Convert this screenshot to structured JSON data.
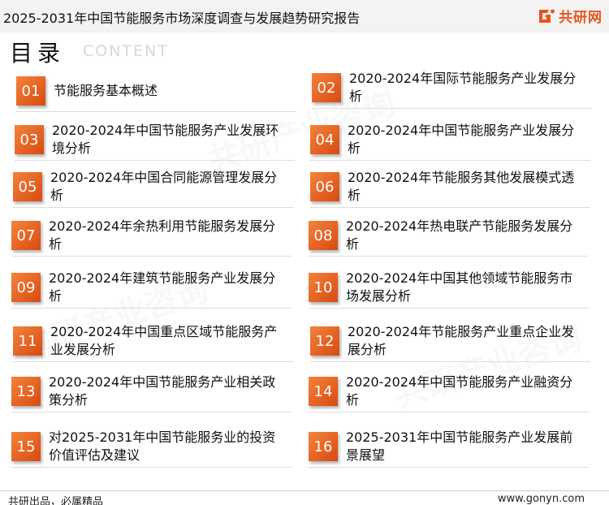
{
  "header": {
    "title": "2025-2031年中国节能服务市场深度调查与发展趋势研究报告",
    "logo_text": "共研网",
    "brand_color": "#e8541c"
  },
  "toc": {
    "heading": "目录",
    "subheading": "CONTENT",
    "items": [
      {
        "num": "01",
        "title": "节能服务基本概述"
      },
      {
        "num": "02",
        "title": "2020-2024年国际节能服务产业发展分析"
      },
      {
        "num": "03",
        "title": "2020-2024年中国节能服务产业发展环境分析"
      },
      {
        "num": "04",
        "title": "2020-2024年中国节能服务产业发展分析"
      },
      {
        "num": "05",
        "title": "2020-2024年中国合同能源管理发展分析"
      },
      {
        "num": "06",
        "title": "2020-2024年节能服务其他发展模式透析"
      },
      {
        "num": "07",
        "title": "2020-2024年余热利用节能服务发展分析"
      },
      {
        "num": "08",
        "title": "2020-2024年热电联产节能服务发展分析"
      },
      {
        "num": "09",
        "title": "2020-2024年建筑节能服务产业发展分析"
      },
      {
        "num": "10",
        "title": "2020-2024年中国其他领域节能服务市场发展分析"
      },
      {
        "num": "11",
        "title": "2020-2024年中国重点区域节能服务产业发展分析"
      },
      {
        "num": "12",
        "title": "2020-2024年节能服务产业重点企业发展分析"
      },
      {
        "num": "13",
        "title": "2020-2024年中国节能服务产业相关政策分析"
      },
      {
        "num": "14",
        "title": "2020-2024年中国节能服务产业融资分析"
      },
      {
        "num": "15",
        "title": "对2025-2031年中国节能服务业的投资价值评估及建议"
      },
      {
        "num": "16",
        "title": "2025-2031年中国节能服务产业发展前景展望"
      }
    ]
  },
  "footer": {
    "left": "共研出品，必属精品",
    "right": "www.gonyn.com"
  }
}
